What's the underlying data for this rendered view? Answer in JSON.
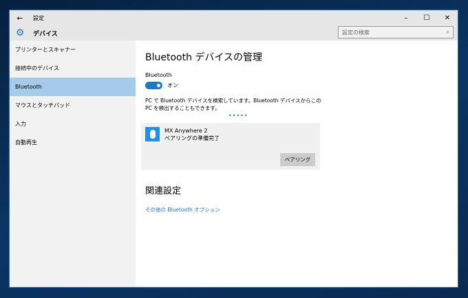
{
  "titlebar": {
    "title": "設定",
    "back": "←",
    "minimize": "–",
    "maximize": "☐",
    "close": "✕"
  },
  "header": {
    "title": "デバイス",
    "search_placeholder": "設定の検索",
    "search_icon": "⌕"
  },
  "sidebar": {
    "items": [
      {
        "label": "プリンターとスキャナー"
      },
      {
        "label": "接続中のデバイス"
      },
      {
        "label": "Bluetooth"
      },
      {
        "label": "マウスとタッチパッド"
      },
      {
        "label": "入力"
      },
      {
        "label": "自動再生"
      }
    ],
    "active": 2
  },
  "main": {
    "title": "Bluetooth デバイスの管理",
    "toggle_label": "Bluetooth",
    "toggle_state": "オン",
    "description": "PC で Bluetooth デバイスを検索しています。Bluetooth デバイスからこの PC を検出することもできます。",
    "progress": "•••••",
    "device": {
      "name": "MX Anywhere 2",
      "status": "ペアリングの準備完了",
      "button": "ペアリング"
    },
    "related_title": "関連設定",
    "related_link": "その他の Bluetooth オプション"
  },
  "colors": {
    "accent": "#1e78c8",
    "active_nav": "#a6cbe8"
  }
}
